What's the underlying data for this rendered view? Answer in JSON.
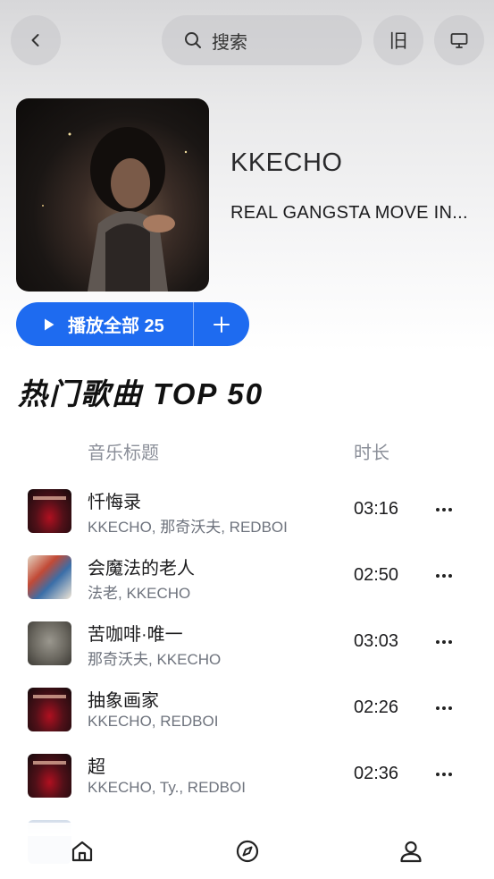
{
  "topbar": {
    "back_icon": "chevron-left-icon",
    "search_placeholder": "搜索",
    "old_label": "旧",
    "desktop_icon": "monitor-icon"
  },
  "header": {
    "artist": "KKECHO",
    "album_title": "REAL GANGSTA MOVE IN...",
    "play_all_label": "播放全部 25",
    "add_icon": "plus-icon"
  },
  "section": {
    "title": "热门歌曲 TOP 50",
    "col_title": "音乐标题",
    "col_duration": "时长"
  },
  "songs": [
    {
      "title": "忏悔录",
      "artists": "KKECHO, 那奇沃夫, REDBOI",
      "duration": "03:16",
      "cover": "red"
    },
    {
      "title": "会魔法的老人",
      "artists": "法老, KKECHO",
      "duration": "02:50",
      "cover": "collage"
    },
    {
      "title": "苦咖啡·唯一",
      "artists": "那奇沃夫, KKECHO",
      "duration": "03:03",
      "cover": "gray"
    },
    {
      "title": "抽象画家",
      "artists": "KKECHO, REDBOI",
      "duration": "02:26",
      "cover": "red"
    },
    {
      "title": "超",
      "artists": "KKECHO, Ty., REDBOI",
      "duration": "02:36",
      "cover": "red"
    }
  ],
  "bottom_nav": {
    "items": [
      "home-icon",
      "compass-icon",
      "user-icon"
    ]
  },
  "colors": {
    "accent": "#1e6bf0",
    "secondary_text": "#6e737d"
  }
}
